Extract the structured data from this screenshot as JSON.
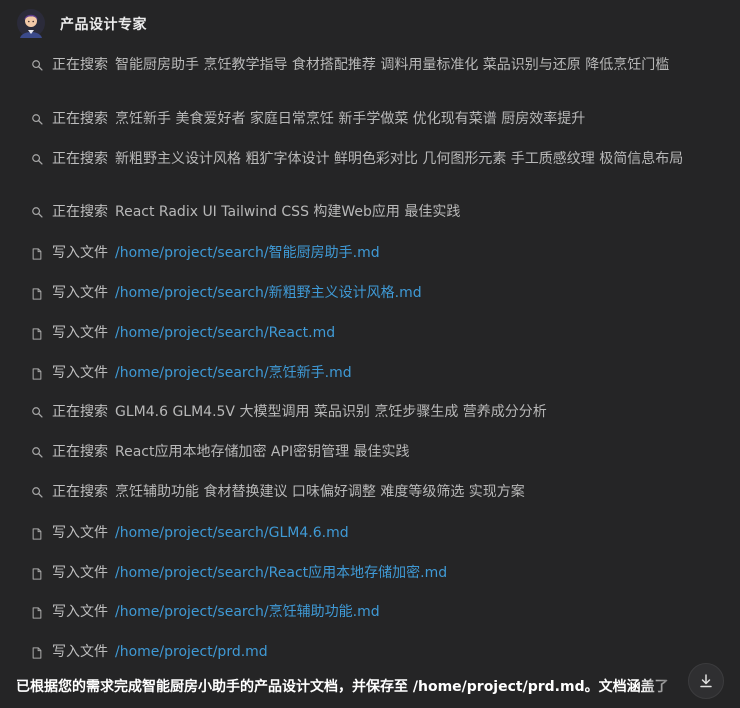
{
  "header": {
    "title": "产品设计专家",
    "avatar_icon": "person-avatar-icon"
  },
  "colors": {
    "background": "#252526",
    "path_link": "#3f9ad6",
    "text": "#b8b8b8"
  },
  "steps": [
    {
      "type": "search",
      "icon": "search-icon",
      "action": "正在搜索",
      "detail": "智能厨房助手 烹饪教学指导 食材搭配推荐 调料用量标准化 菜品识别与还原 降低烹饪门槛"
    },
    {
      "type": "search",
      "icon": "search-icon",
      "action": "正在搜索",
      "detail": "烹饪新手 美食爱好者 家庭日常烹饪 新手学做菜 优化现有菜谱 厨房效率提升"
    },
    {
      "type": "search",
      "icon": "search-icon",
      "action": "正在搜索",
      "detail": "新粗野主义设计风格 粗犷字体设计 鲜明色彩对比 几何图形元素 手工质感纹理 极简信息布局"
    },
    {
      "type": "search",
      "icon": "search-icon",
      "action": "正在搜索",
      "detail": "React Radix UI Tailwind CSS 构建Web应用 最佳实践"
    },
    {
      "type": "write",
      "icon": "file-icon",
      "action": "写入文件",
      "detail": "/home/project/search/智能厨房助手.md"
    },
    {
      "type": "write",
      "icon": "file-icon",
      "action": "写入文件",
      "detail": "/home/project/search/新粗野主义设计风格.md"
    },
    {
      "type": "write",
      "icon": "file-icon",
      "action": "写入文件",
      "detail": "/home/project/search/React.md"
    },
    {
      "type": "write",
      "icon": "file-icon",
      "action": "写入文件",
      "detail": "/home/project/search/烹饪新手.md"
    },
    {
      "type": "search",
      "icon": "search-icon",
      "action": "正在搜索",
      "detail": "GLM4.6 GLM4.5V 大模型调用 菜品识别 烹饪步骤生成 营养成分分析"
    },
    {
      "type": "search",
      "icon": "search-icon",
      "action": "正在搜索",
      "detail": "React应用本地存储加密 API密钥管理 最佳实践"
    },
    {
      "type": "search",
      "icon": "search-icon",
      "action": "正在搜索",
      "detail": "烹饪辅助功能 食材替换建议 口味偏好调整 难度等级筛选 实现方案"
    },
    {
      "type": "write",
      "icon": "file-icon",
      "action": "写入文件",
      "detail": "/home/project/search/GLM4.6.md"
    },
    {
      "type": "write",
      "icon": "file-icon",
      "action": "写入文件",
      "detail": "/home/project/search/React应用本地存储加密.md"
    },
    {
      "type": "write",
      "icon": "file-icon",
      "action": "写入文件",
      "detail": "/home/project/search/烹饪辅助功能.md"
    },
    {
      "type": "write",
      "icon": "file-icon",
      "action": "写入文件",
      "detail": "/home/project/prd.md"
    }
  ],
  "summary": {
    "text": "已根据您的需求完成智能厨房小助手的产品设计文档，并保存至 /home/project/prd.md。文档涵盖了"
  },
  "scroll_button": {
    "icon": "scroll-to-bottom-icon"
  }
}
